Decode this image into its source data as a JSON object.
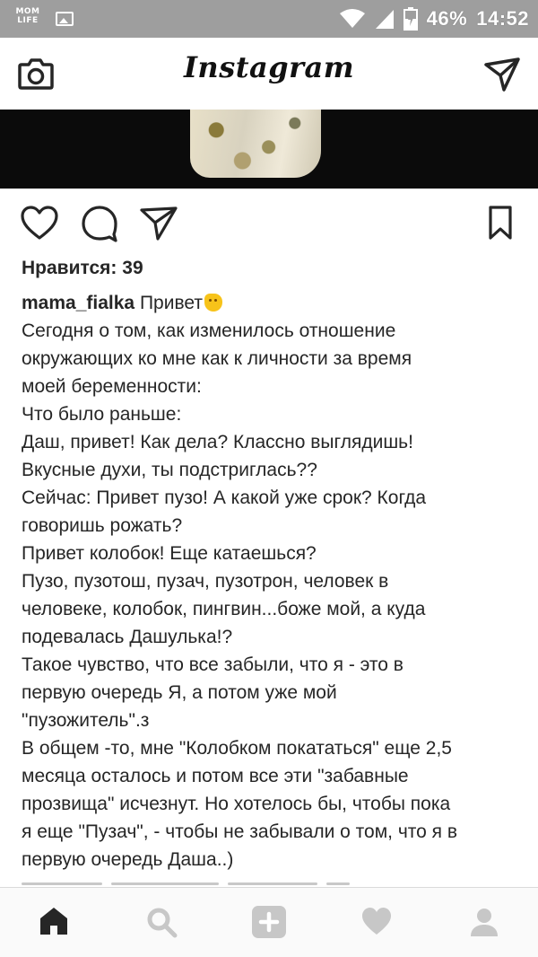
{
  "status_bar": {
    "app_logo_line1": "MOM",
    "app_logo_line2": "LIFE",
    "battery": "46%",
    "time": "14:52"
  },
  "header": {
    "title": "Instagram"
  },
  "post": {
    "likes_text": "Нравится: 39",
    "username": "mama_fialka",
    "caption_first": "Привет",
    "caption_lines": [
      "Сегодня о том, как изменилось отношение",
      "окружающих ко мне как к личности за время",
      "моей беременности:",
      "Что было раньше:",
      "Даш, привет! Как дела? Классно выглядишь!",
      "Вкусные духи, ты подстриглась??",
      "Сейчас: Привет пузо! А какой уже срок? Когда",
      "говоришь рожать?",
      "Привет колобок! Еще катаешься?",
      "Пузо, пузотош, пузач, пузотрон, человек в",
      "человеке, колобок, пингвин...боже мой, а куда",
      "подевалась Дашулька!?",
      "Такое чувство, что все забыли, что я - это в",
      "первую очередь Я, а потом уже мой",
      "\"пузожитель\".з",
      "В общем -то, мне \"Колобком покататься\" еще 2,5",
      "месяца осталось и потом все эти \"забавные",
      "прозвища\" исчезнут. Но хотелось бы, чтобы пока",
      "я еще \"Пузач\", - чтобы не забывали о том, что я в",
      "первую очередь Даша..)"
    ]
  },
  "icons": {
    "camera": "camera-icon",
    "send": "direct-send-icon",
    "like": "heart-icon",
    "comment": "comment-icon",
    "share": "share-icon",
    "save": "bookmark-icon",
    "nav": [
      "home-icon",
      "search-icon",
      "add-icon",
      "activity-heart-icon",
      "profile-icon"
    ]
  },
  "colors": {
    "status_bar": "#9e9e9e",
    "text": "#262626",
    "nav_inactive": "#c7c7c7"
  }
}
